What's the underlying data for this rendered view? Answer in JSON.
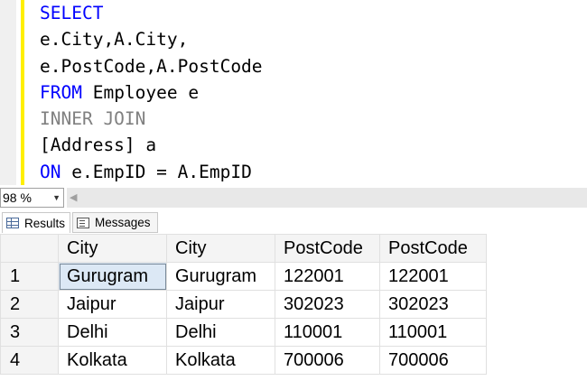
{
  "editor": {
    "lines": [
      [
        {
          "t": "SELECT",
          "c": "kw-blue"
        }
      ],
      [
        {
          "t": "e.City,A.City,",
          "c": "text-ident"
        }
      ],
      [
        {
          "t": "e.PostCode,A.PostCode",
          "c": "text-ident"
        }
      ],
      [
        {
          "t": "FROM",
          "c": "kw-blue"
        },
        {
          "t": " Employee e",
          "c": "text-ident"
        }
      ],
      [
        {
          "t": "INNER JOIN",
          "c": "kw-gray"
        }
      ],
      [
        {
          "t": "[Address] a",
          "c": "text-ident"
        }
      ],
      [
        {
          "t": "ON",
          "c": "kw-blue"
        },
        {
          "t": " e.EmpID = A.EmpID",
          "c": "text-ident"
        }
      ]
    ]
  },
  "zoom": {
    "value": "98 %"
  },
  "tabs": {
    "results": "Results",
    "messages": "Messages"
  },
  "results": {
    "columns": [
      "City",
      "City",
      "PostCode",
      "PostCode"
    ],
    "rows": [
      {
        "num": "1",
        "cells": [
          "Gurugram",
          "Gurugram",
          "122001",
          "122001"
        ]
      },
      {
        "num": "2",
        "cells": [
          "Jaipur",
          "Jaipur",
          "302023",
          "302023"
        ]
      },
      {
        "num": "3",
        "cells": [
          "Delhi",
          "Delhi",
          "110001",
          "110001"
        ]
      },
      {
        "num": "4",
        "cells": [
          "Kolkata",
          "Kolkata",
          "700006",
          "700006"
        ]
      }
    ]
  }
}
